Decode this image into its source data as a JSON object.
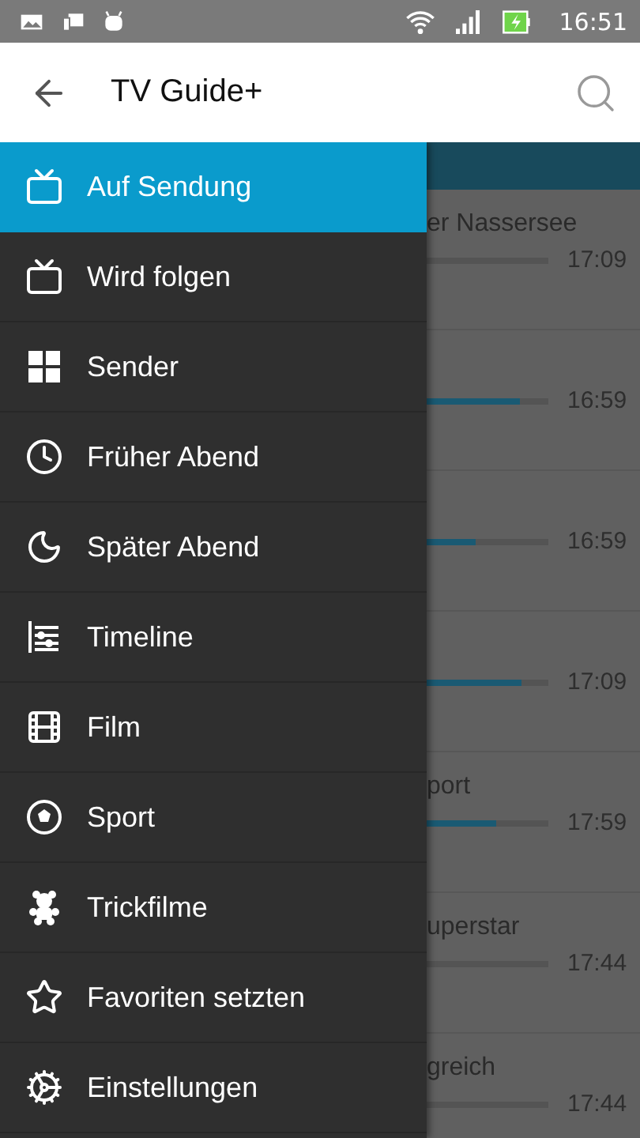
{
  "status_bar": {
    "time": "16:51"
  },
  "app_bar": {
    "title": "TV Guide+"
  },
  "drawer": {
    "items": [
      {
        "label": "Auf Sendung",
        "kind": "live",
        "selected": true
      },
      {
        "label": "Wird folgen",
        "kind": "next",
        "selected": false
      },
      {
        "label": "Sender",
        "kind": "channels",
        "selected": false
      },
      {
        "label": "Früher Abend",
        "kind": "early",
        "selected": false
      },
      {
        "label": "Später Abend",
        "kind": "late",
        "selected": false
      },
      {
        "label": "Timeline",
        "kind": "timeline",
        "selected": false
      },
      {
        "label": "Film",
        "kind": "film",
        "selected": false
      },
      {
        "label": "Sport",
        "kind": "sport",
        "selected": false
      },
      {
        "label": "Trickfilme",
        "kind": "cartoons",
        "selected": false
      },
      {
        "label": "Favoriten setzten",
        "kind": "favorites",
        "selected": false
      },
      {
        "label": "Einstellungen",
        "kind": "settings",
        "selected": false
      }
    ]
  },
  "programs": [
    {
      "title": "er Nassersee",
      "time": "17:09"
    },
    {
      "level": 0.77,
      "time": "16:59"
    },
    {
      "level": 0.4,
      "time": "16:59"
    },
    {
      "level": 0.78,
      "time": "17:09"
    },
    {
      "title": "port",
      "level": 0.57,
      "time": "17:59"
    },
    {
      "title": "uperstar",
      "time": "17:44"
    },
    {
      "title": "greich",
      "time": "17:44"
    }
  ]
}
